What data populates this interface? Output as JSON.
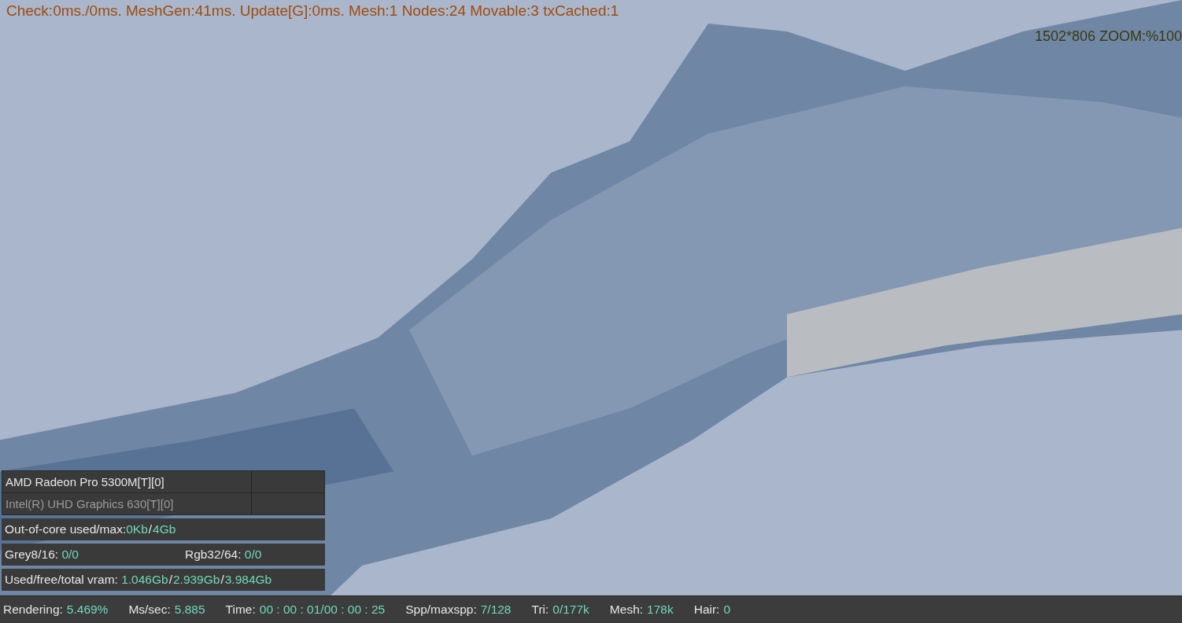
{
  "viewport": {
    "stats_line": "Check:0ms./0ms. MeshGen:41ms. Update[G]:0ms. Mesh:1 Nodes:24 Movable:3 txCached:1",
    "zoom_readout": "1502*806 ZOOM:%100"
  },
  "devices": [
    {
      "name": "AMD Radeon Pro 5300M[T][0]",
      "enabled": true
    },
    {
      "name": "Intel(R) UHD Graphics 630[T][0]",
      "enabled": false
    }
  ],
  "memory_rows": [
    [
      {
        "kind": "label",
        "text": "Out-of-core used/max:"
      },
      {
        "kind": "value",
        "text": "0Kb"
      },
      {
        "kind": "sep",
        "text": "/"
      },
      {
        "kind": "value",
        "text": "4Gb"
      }
    ],
    [
      {
        "kind": "label",
        "text": "Grey8/16: "
      },
      {
        "kind": "value",
        "text": "0/0"
      },
      {
        "kind": "gap"
      },
      {
        "kind": "label",
        "text": "Rgb32/64: "
      },
      {
        "kind": "value",
        "text": "0/0"
      }
    ],
    [
      {
        "kind": "label",
        "text": "Used/free/total vram: "
      },
      {
        "kind": "value",
        "text": "1.046Gb"
      },
      {
        "kind": "sep",
        "text": "/"
      },
      {
        "kind": "value",
        "text": "2.939Gb"
      },
      {
        "kind": "sep",
        "text": "/"
      },
      {
        "kind": "value",
        "text": "3.984Gb"
      }
    ]
  ],
  "status_bar": [
    {
      "label": "Rendering:",
      "value": "5.469%"
    },
    {
      "label": "Ms/sec:",
      "value": "5.885"
    },
    {
      "label": "Time:",
      "value": "00 : 00 : 01/00 : 00 : 25"
    },
    {
      "label": "Spp/maxspp:",
      "value": "7/128"
    },
    {
      "label": "Tri:",
      "value": "0/177k"
    },
    {
      "label": "Mesh:",
      "value": "178k"
    },
    {
      "label": "Hair:",
      "value": "0"
    }
  ]
}
